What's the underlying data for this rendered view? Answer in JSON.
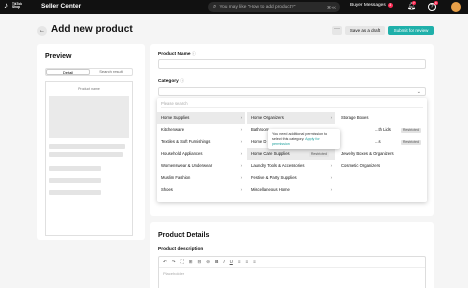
{
  "topbar": {
    "logo_text": "TikTok Shop",
    "app_name": "Seller Center",
    "search_placeholder": "You may like \"How to add product?\"",
    "search_shortcut": "⌘+K",
    "buyer_messages": "Buyer Messages",
    "buyer_messages_count": "3",
    "notif_count": "7",
    "help_count": "9",
    "help_glyph": "?"
  },
  "header": {
    "title": "Add new product",
    "more": "···",
    "save_draft": "Save as a draft",
    "submit": "Submit for review",
    "back_glyph": "←"
  },
  "preview": {
    "title": "Preview",
    "tabs": [
      "Detail",
      "Search result"
    ],
    "phone_label": "Product name"
  },
  "form": {
    "product_name_label": "Product Name",
    "category_label": "Category",
    "info_glyph": "ⓘ"
  },
  "category_dropdown": {
    "search_placeholder": "Please search",
    "col1": [
      "Home Supplies",
      "Kitchenware",
      "Textiles & Soft Furnishings",
      "Household Appliances",
      "Womenswear & Underwear",
      "Muslim Fashion",
      "Shoes"
    ],
    "col2": [
      "Home Organizers",
      "Bathroom",
      "Home D",
      "Home Care Supplies",
      "Laundry Tools & Accessories",
      "Festive & Party Supplies",
      "Miscellaneous Home"
    ],
    "col3": [
      "Storage Boxes",
      "...th Lids",
      "...s",
      "Jewelry Boxes & Organizers",
      "Cosmetic Organizers"
    ],
    "restricted_label": "Restricted",
    "tooltip_text": "You need additional permission to select this category.",
    "tooltip_link": "Apply for permission"
  },
  "details": {
    "title": "Product Details",
    "description_label": "Product description",
    "editor_placeholder": "Placeholder",
    "toolbar": [
      "↶",
      "↷",
      "⛶",
      "⊞",
      "⊟",
      "⊖",
      "B",
      "I",
      "U",
      "≡",
      "≡",
      "≡"
    ]
  },
  "colors": {
    "accent": "#1fb0aa",
    "badge": "#fe2c55",
    "topbar": "#111111"
  }
}
